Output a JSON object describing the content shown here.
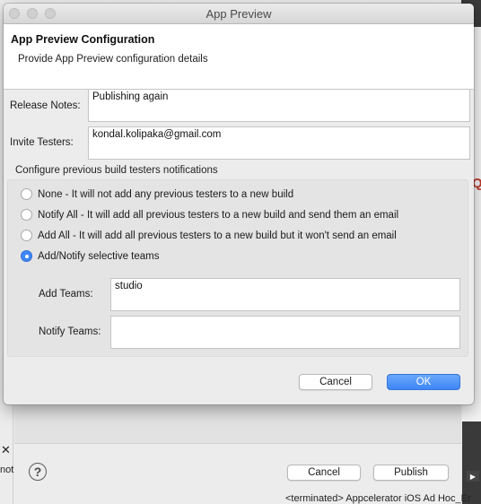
{
  "window": {
    "title": "App Preview"
  },
  "header": {
    "title": "App Preview Configuration",
    "description": "Provide App Preview configuration details"
  },
  "form": {
    "release_notes_label": "Release Notes:",
    "release_notes_value": "Publishing again",
    "invite_testers_label": "Invite Testers:",
    "invite_testers_value": "kondal.kolipaka@gmail.com"
  },
  "notifications": {
    "section_title": "Configure previous build testers notifications",
    "options": [
      {
        "label": "None - It will not add any previous testers to a new build",
        "selected": false
      },
      {
        "label": "Notify All - It will add all previous testers to a new build and send them an email",
        "selected": false
      },
      {
        "label": "Add All - It will add all previous testers to a new build but it won't send an email",
        "selected": false
      },
      {
        "label": "Add/Notify selective teams",
        "selected": true
      }
    ],
    "add_teams_label": "Add Teams:",
    "add_teams_value": "studio",
    "notify_teams_label": "Notify Teams:",
    "notify_teams_value": ""
  },
  "buttons": {
    "cancel": "Cancel",
    "ok": "OK"
  },
  "background": {
    "help_glyph": "?",
    "cancel": "Cancel",
    "publish": "Publish",
    "console_text": "<terminated> Appcelerator iOS Ad Hoc_Er",
    "side_text": "not",
    "red_glyph": "Q"
  },
  "colors": {
    "accent": "#3f86f6",
    "header_bg": "#ffffff",
    "dialog_bg": "#ececec"
  }
}
